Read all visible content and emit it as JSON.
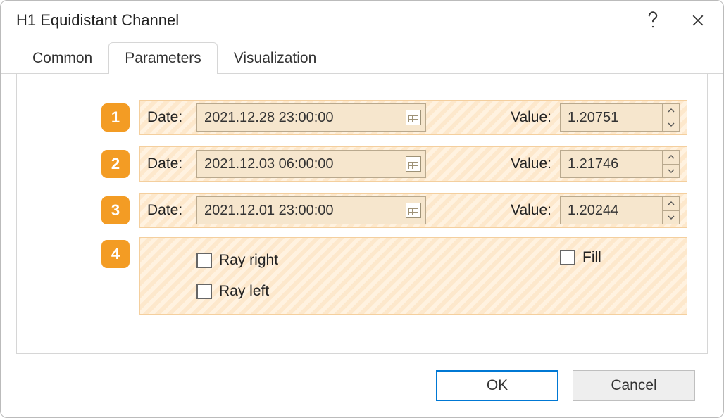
{
  "window": {
    "title": "H1 Equidistant Channel"
  },
  "tabs": {
    "common": "Common",
    "parameters": "Parameters",
    "visualization": "Visualization"
  },
  "labels": {
    "date": "Date:",
    "value": "Value:",
    "ray_right": "Ray right",
    "ray_left": "Ray left",
    "fill": "Fill"
  },
  "rows": [
    {
      "n": "1",
      "date": "2021.12.28 23:00:00",
      "value": "1.20751"
    },
    {
      "n": "2",
      "date": "2021.12.03 06:00:00",
      "value": "1.21746"
    },
    {
      "n": "3",
      "date": "2021.12.01 23:00:00",
      "value": "1.20244"
    }
  ],
  "row4": {
    "n": "4"
  },
  "buttons": {
    "ok": "OK",
    "cancel": "Cancel"
  }
}
